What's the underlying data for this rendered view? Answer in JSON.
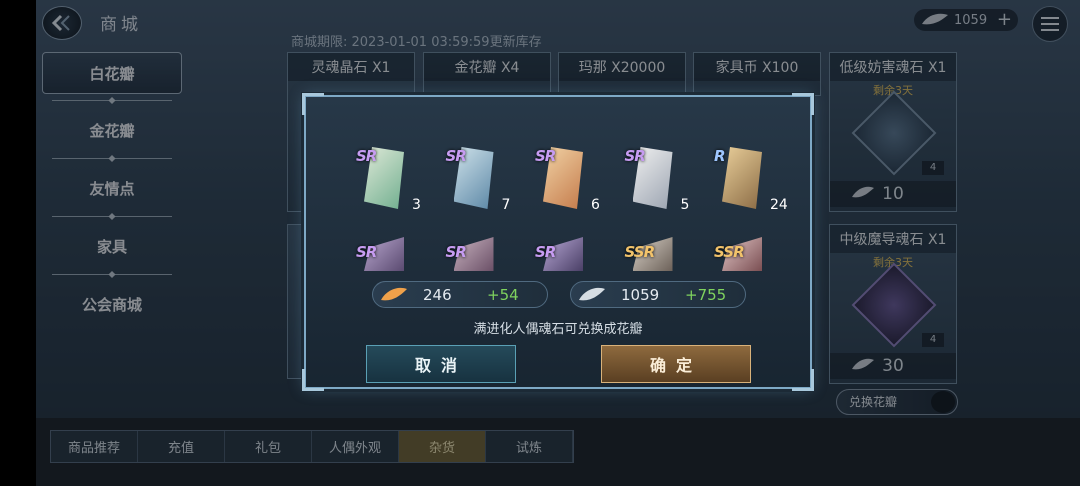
{
  "header": {
    "title": "商城",
    "restock_text": "商城期限:  2023-01-01 03:59:59更新库存",
    "currency_amount": "1059",
    "plus": "+"
  },
  "sidebar": {
    "items": [
      {
        "label": "白花瓣",
        "active": true
      },
      {
        "label": "金花瓣",
        "active": false
      },
      {
        "label": "友情点",
        "active": false
      },
      {
        "label": "家具",
        "active": false
      },
      {
        "label": "公会商城",
        "active": false
      }
    ]
  },
  "shop": {
    "cards_row1": [
      {
        "title": "灵魂晶石 X1"
      },
      {
        "title": "金花瓣 X4"
      },
      {
        "title": "玛那 X20000"
      },
      {
        "title": "家具币 X100"
      },
      {
        "title": "低级妨害魂石 X1",
        "subtitle": "剩余3天",
        "qty": "4",
        "price": "10"
      }
    ],
    "cards_row2": [
      {
        "title": "中级魔导魂石 X1",
        "subtitle": "剩余3天",
        "qty": "4",
        "price": "30"
      }
    ],
    "exchange_button": "兑换花瓣"
  },
  "bottom_tabs": [
    {
      "label": "商品推荐",
      "active": false
    },
    {
      "label": "充值",
      "active": false
    },
    {
      "label": "礼包",
      "active": false
    },
    {
      "label": "人偶外观",
      "active": false
    },
    {
      "label": "杂货",
      "active": true
    },
    {
      "label": "试炼",
      "active": false
    }
  ],
  "modal": {
    "row1": [
      {
        "rarity": "SR",
        "count": "3"
      },
      {
        "rarity": "SR",
        "count": "7"
      },
      {
        "rarity": "SR",
        "count": "6"
      },
      {
        "rarity": "SR",
        "count": "5"
      },
      {
        "rarity": "R",
        "count": "24"
      }
    ],
    "row2": [
      {
        "rarity": "SR"
      },
      {
        "rarity": "SR"
      },
      {
        "rarity": "SR"
      },
      {
        "rarity": "SSR"
      },
      {
        "rarity": "SSR"
      }
    ],
    "gold": {
      "value": "246",
      "gain": "+54"
    },
    "white": {
      "value": "1059",
      "gain": "+755"
    },
    "note": "满进化人偶魂石可兑换成花瓣",
    "cancel_label": "取消",
    "confirm_label": "确定"
  },
  "colors": {
    "sr": "#c79cf2",
    "r": "#9fc7ff",
    "ssr": "#f2c36b",
    "gain": "#7fd35e"
  }
}
